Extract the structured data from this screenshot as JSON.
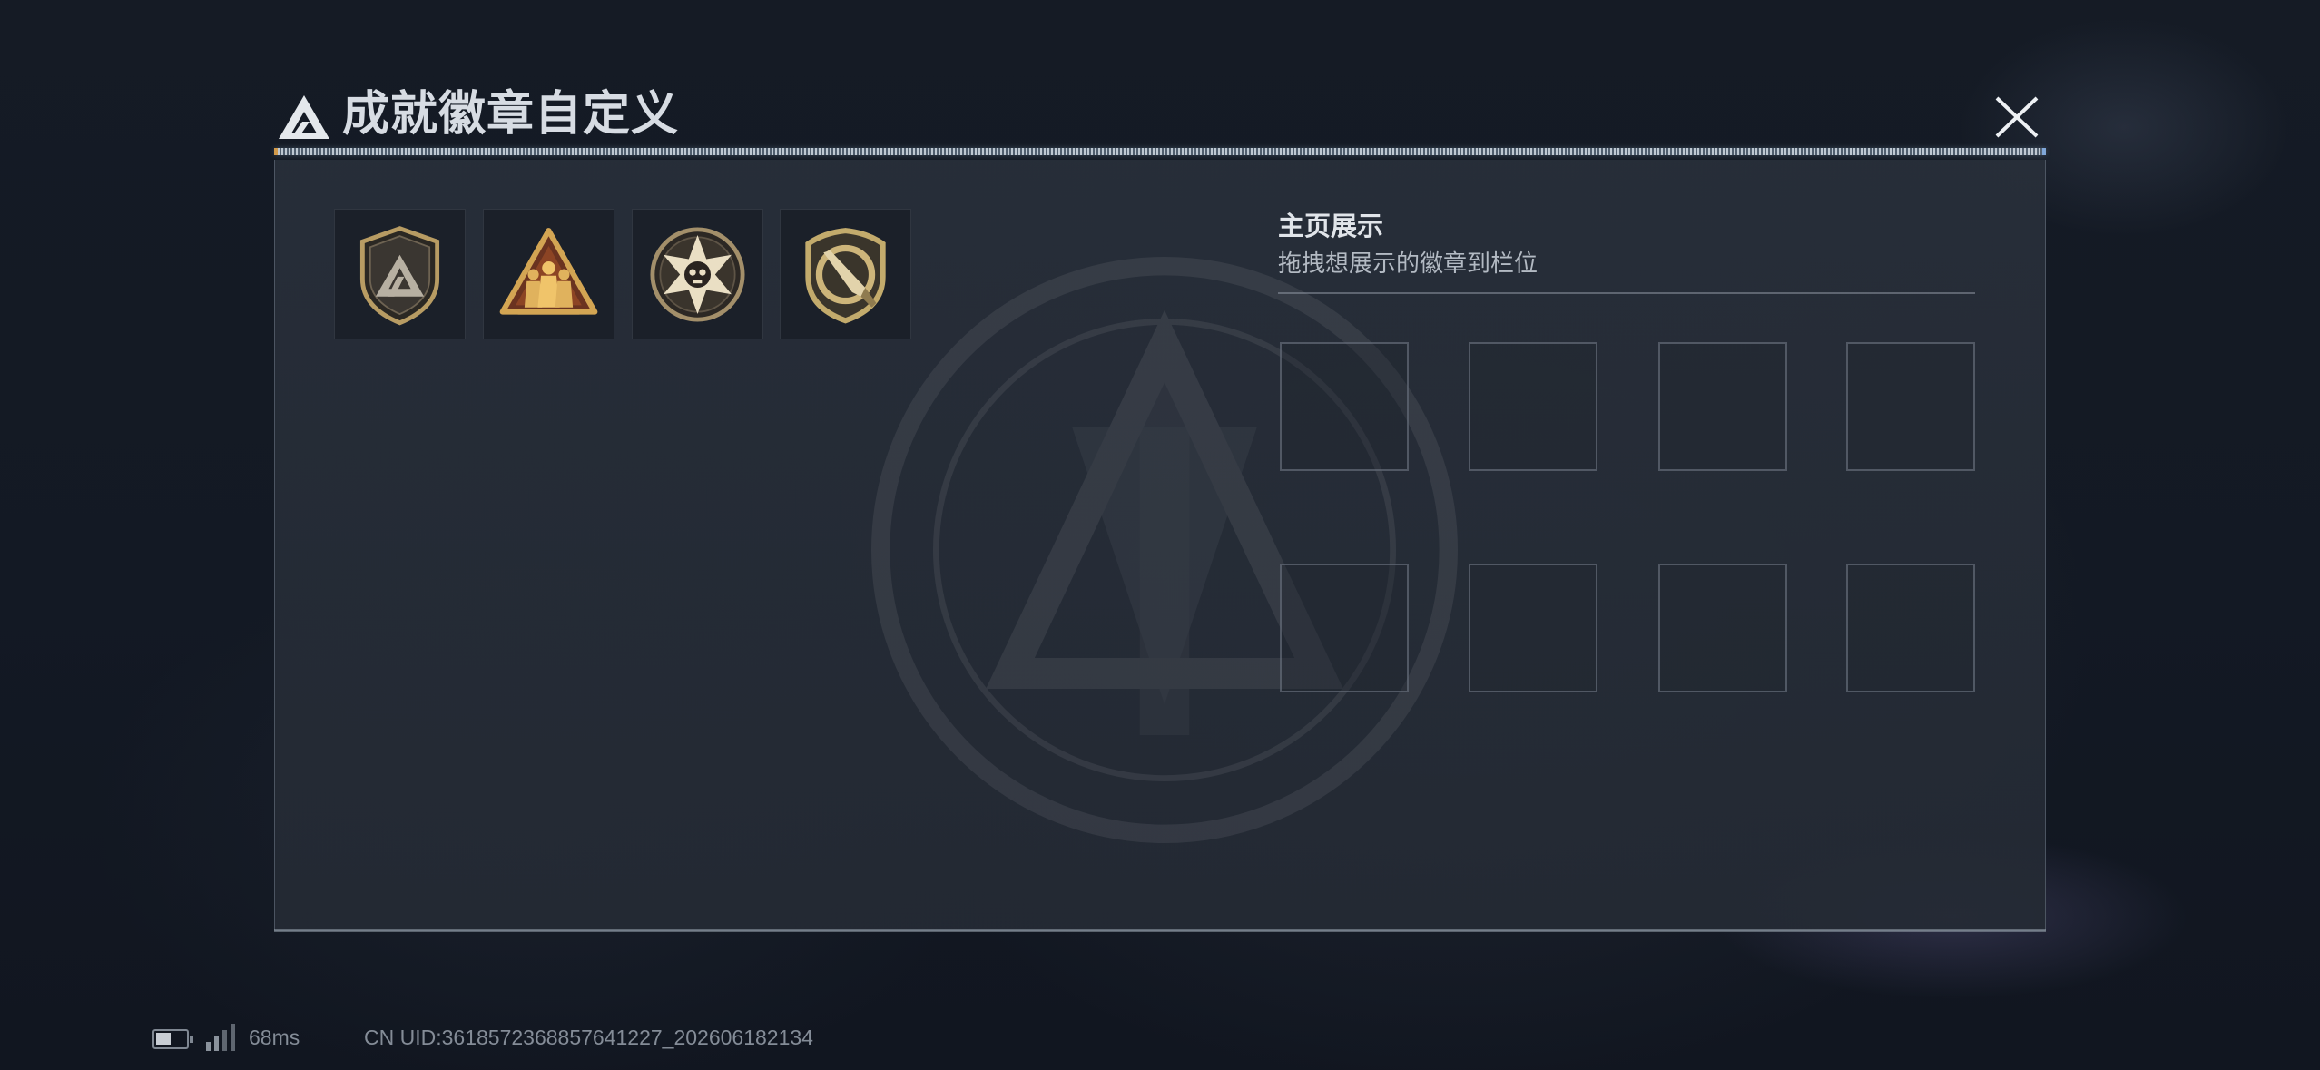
{
  "window": {
    "title": "成就徽章自定义",
    "logo_icon": "delta-logo-icon",
    "close_icon": "close-icon"
  },
  "badges": [
    {
      "icon": "triangle-shield-badge-icon"
    },
    {
      "icon": "squad-triangle-badge-icon"
    },
    {
      "icon": "star-skull-badge-icon"
    },
    {
      "icon": "knife-shield-badge-icon"
    }
  ],
  "showcase": {
    "heading": "主页展示",
    "hint": "拖拽想展示的徽章到栏位"
  },
  "status": {
    "battery_level": 0.5,
    "ping": "68ms",
    "uid": "CN UID:3618572368857641227_202606182134"
  },
  "colors": {
    "badge_gold": "#c2a468",
    "title_text": "#d7dce3",
    "secondary_text": "#b3bac3",
    "slot_border": "#70788580"
  }
}
